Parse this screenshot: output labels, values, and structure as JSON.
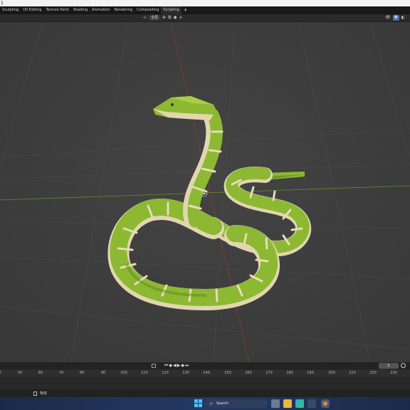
{
  "window": {
    "title": "1"
  },
  "workspaces": {
    "tabs": [
      {
        "label": "Sculpting"
      },
      {
        "label": "UV Editing"
      },
      {
        "label": "Texture Paint"
      },
      {
        "label": "Shading"
      },
      {
        "label": "Animation"
      },
      {
        "label": "Rendering"
      },
      {
        "label": "Compositing"
      },
      {
        "label": "Scripting",
        "active": true
      }
    ],
    "add_label": "+"
  },
  "viewport_header": {
    "transform_orientation": "全局",
    "icons": [
      "transform-orientation-icon",
      "pivot-icon",
      "snap-icon",
      "proportional-edit-icon",
      "falloff-icon"
    ],
    "right_icons": [
      "visibility-icon",
      "gizmo-icon",
      "overlay-icon"
    ]
  },
  "scene": {
    "object": "low-poly snake",
    "colors": {
      "body": "#8cb832",
      "body_dark": "#5e8a1e",
      "belly": "#e2d6b0",
      "background": "#3d3d3d",
      "x_axis": "#8a3a3a",
      "y_axis": "#6b8a2a"
    }
  },
  "timeline": {
    "current_frame": "1",
    "ruler_ticks": [
      "0",
      "50",
      "60",
      "70",
      "80",
      "90",
      "100",
      "110",
      "120",
      "130",
      "140",
      "150",
      "160",
      "170",
      "180",
      "190",
      "200",
      "210",
      "220",
      "230"
    ]
  },
  "status_bar": {
    "text": "物体"
  },
  "taskbar": {
    "search_label": "Search",
    "apps": [
      "task-view-icon",
      "file-explorer-icon",
      "edge-icon",
      "store-icon",
      "blender-icon"
    ]
  }
}
